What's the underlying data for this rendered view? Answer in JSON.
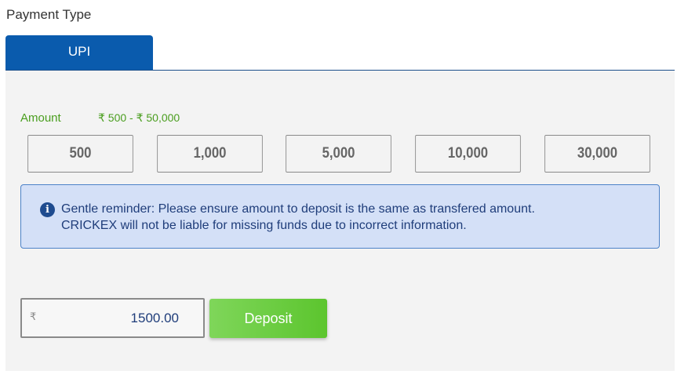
{
  "payment": {
    "title": "Payment Type",
    "tabs": [
      {
        "label": "UPI",
        "active": true
      }
    ]
  },
  "amount": {
    "label": "Amount",
    "range": "₹ 500 - ₹ 50,000",
    "quick_options": [
      "500",
      "1,000",
      "5,000",
      "10,000",
      "30,000"
    ]
  },
  "reminder": {
    "icon": "info-icon",
    "line1": "Gentle reminder: Please ensure amount to deposit is the same as transfered amount.",
    "line2": "CRICKEX will not be liable for missing funds due to incorrect information."
  },
  "deposit": {
    "currency_symbol": "₹",
    "value": "1500.00",
    "button_label": "Deposit"
  },
  "colors": {
    "tab_active": "#0a5bad",
    "accent_green": "#4a9e1f",
    "deposit_button": "#6ccf3f",
    "reminder_bg": "#d4e0f7",
    "reminder_text": "#1f3d7a"
  }
}
